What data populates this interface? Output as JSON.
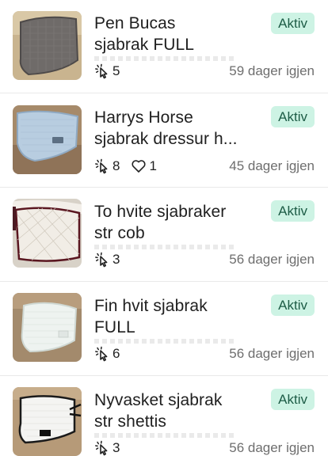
{
  "listings": [
    {
      "title": "Pen Bucas\nsjabrak FULL",
      "status": "Aktiv",
      "clicks": "5",
      "favorites": null,
      "days_left": "59 dager igjen",
      "thumb_icon": "saddle-pad-gray-photo"
    },
    {
      "title": "Harrys Horse\nsjabrak dressur h...",
      "status": "Aktiv",
      "clicks": "8",
      "favorites": "1",
      "days_left": "45 dager igjen",
      "thumb_icon": "saddle-pad-lightblue-photo"
    },
    {
      "title": "To hvite sjabraker\nstr cob",
      "status": "Aktiv",
      "clicks": "3",
      "favorites": null,
      "days_left": "56 dager igjen",
      "thumb_icon": "saddle-pad-white-maroon-photo"
    },
    {
      "title": "Fin hvit sjabrak\nFULL",
      "status": "Aktiv",
      "clicks": "6",
      "favorites": null,
      "days_left": "56 dager igjen",
      "thumb_icon": "saddle-pad-white-photo"
    },
    {
      "title": "Nyvasket sjabrak\nstr shettis",
      "status": "Aktiv",
      "clicks": "3",
      "favorites": null,
      "days_left": "56 dager igjen",
      "thumb_icon": "saddle-pad-white-black-photo"
    }
  ],
  "colors": {
    "badge_bg": "#cdf3e4",
    "badge_text": "#1d5c46",
    "muted_text": "#6e6e6e"
  }
}
